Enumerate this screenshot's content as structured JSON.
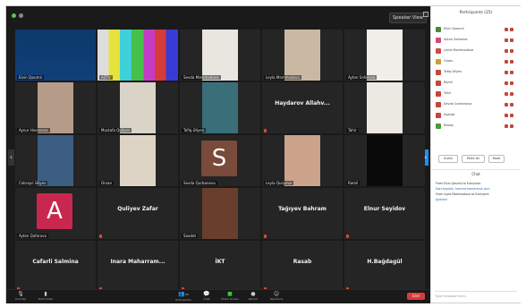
{
  "meeting": {
    "speaker_view": "Speaker View",
    "end": "End"
  },
  "tiles": [
    {
      "name": "Elvin Qasımlı",
      "kind": "video"
    },
    {
      "name": "AZTV",
      "kind": "video"
    },
    {
      "name": "Sevda Məmmədova",
      "kind": "video"
    },
    {
      "name": "Leyla Məmmədova",
      "kind": "video"
    },
    {
      "name": "Aytən Səfərova",
      "kind": "video"
    },
    {
      "name": "Aynur Həsənova",
      "kind": "video"
    },
    {
      "name": "Mustafa Quliyev",
      "kind": "video"
    },
    {
      "name": "Tofiq Əliyev",
      "kind": "video"
    },
    {
      "name": "Haydarov Allahv...",
      "kind": "name"
    },
    {
      "name": "Tahir",
      "kind": "video"
    },
    {
      "name": "Cəbrayıl Əliyev",
      "kind": "video"
    },
    {
      "name": "Orxan",
      "kind": "video"
    },
    {
      "name": "Sevda Qurbanova",
      "kind": "avatar",
      "letter": "S",
      "color": "#7a4a3a"
    },
    {
      "name": "Leyla Quliyeva",
      "kind": "video"
    },
    {
      "name": "Ramil",
      "kind": "video"
    },
    {
      "name": "Aytən Qafarova",
      "kind": "avatar",
      "letter": "A",
      "color": "#c8284f"
    },
    {
      "name": "Quliyev Zafar",
      "kind": "name"
    },
    {
      "name": "Səadət",
      "kind": "video"
    },
    {
      "name": "Tağıyev Bəhram",
      "kind": "name"
    },
    {
      "name": "Elnur Seyidov",
      "kind": "name"
    },
    {
      "name": "Cafarli Salmina",
      "kind": "name"
    },
    {
      "name": "Inara Maharram...",
      "kind": "name"
    },
    {
      "name": "İKT",
      "kind": "name"
    },
    {
      "name": "Rasab",
      "kind": "name"
    },
    {
      "name": "H.Bağdagül",
      "kind": "name"
    }
  ],
  "toolbar": {
    "mute": "Unmute",
    "video": "Start Video",
    "participants": "Participants",
    "participants_count": "25",
    "chat": "Chat",
    "share": "Share Screen",
    "record": "Record",
    "reactions": "Reactions"
  },
  "panel": {
    "title": "Participants (25)",
    "participants": [
      {
        "name": "Elvin Qasımlı",
        "color": "#4a8a3a"
      },
      {
        "name": "Aytən Səfərova",
        "color": "#d04a7a"
      },
      {
        "name": "Leyla Məmmədova",
        "color": "#d04a4a"
      },
      {
        "name": "Orxan",
        "color": "#c9a030"
      },
      {
        "name": "Tofiq Əliyev",
        "color": "#c4473a"
      },
      {
        "name": "Ramil",
        "color": "#c4473a"
      },
      {
        "name": "Tahir",
        "color": "#c4473a"
      },
      {
        "name": "Sevda Qurbanova",
        "color": "#c4473a"
      },
      {
        "name": "Səadət",
        "color": "#c4473a"
      },
      {
        "name": "Rasab",
        "color": "#4a9a3a"
      }
    ],
    "invite": "Invite",
    "mute_all": "Mute All",
    "more": "More",
    "chat_title": "Chat",
    "messages": [
      "From Elvin Qasımlı to Everyone:",
      "Dərs başladı, hamınız kameranızı açın",
      "From Leyla Məmmədova to Everyone:",
      "Aydındır"
    ],
    "input_placeholder": "Type message here..."
  }
}
